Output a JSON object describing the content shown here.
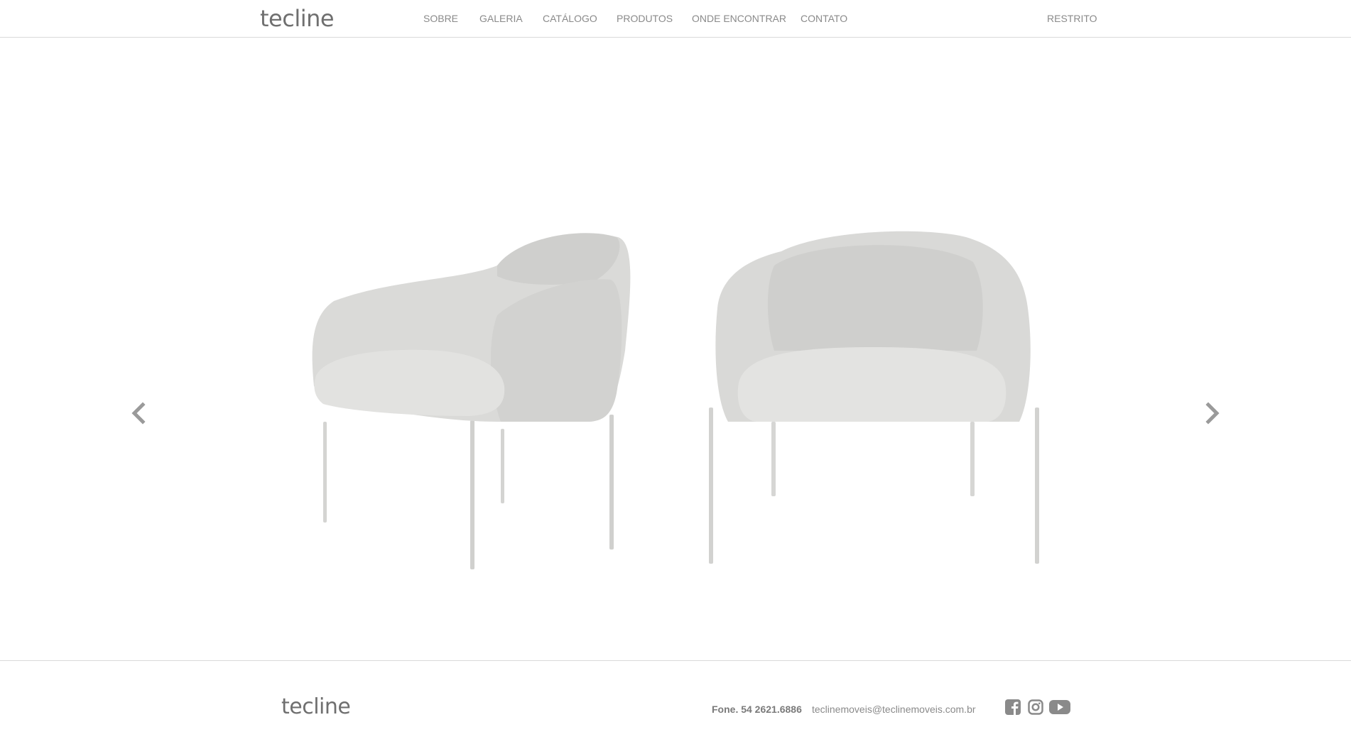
{
  "header": {
    "logo": "tecline",
    "nav": [
      {
        "label": "SOBRE"
      },
      {
        "label": "GALERIA"
      },
      {
        "label": "CATÁLOGO"
      },
      {
        "label": "PRODUTOS"
      },
      {
        "label": "ONDE ENCONTRAR"
      },
      {
        "label": "CONTATO"
      }
    ],
    "restricted": "RESTRITO"
  },
  "slider": {
    "prev_icon": "chevron-left-icon",
    "next_icon": "chevron-right-icon",
    "image_subject": "two light grey upholstered armchairs with thin metal legs"
  },
  "footer": {
    "logo": "tecline",
    "phone": "Fone. 54 2621.6886",
    "email": "teclinemoveis@teclinemoveis.com.br",
    "social": [
      "facebook-icon",
      "instagram-icon",
      "youtube-icon"
    ]
  },
  "colors": {
    "text": "#7a7a7a",
    "border": "#d9d9d9",
    "chair": "#d8d8d6",
    "arrow": "#9a9a9a"
  }
}
